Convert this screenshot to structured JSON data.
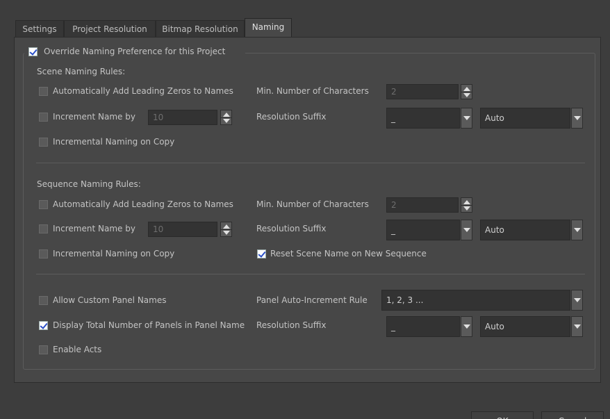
{
  "tabs": [
    {
      "label": "Settings"
    },
    {
      "label": "Project Resolution"
    },
    {
      "label": "Bitmap Resolution"
    },
    {
      "label": "Naming"
    }
  ],
  "override": {
    "label": "Override Naming Preference for this Project",
    "checked": true
  },
  "scene": {
    "title": "Scene Naming Rules:",
    "leading_zeros": {
      "label": "Automatically Add Leading Zeros to Names",
      "checked": false
    },
    "min_chars": {
      "label": "Min. Number of Characters",
      "value": "2"
    },
    "increment": {
      "label": "Increment Name by",
      "value": "10",
      "checked": false
    },
    "res_suffix": {
      "label": "Resolution Suffix",
      "value": "_",
      "mode": "Auto"
    },
    "incremental_copy": {
      "label": "Incremental Naming on Copy",
      "checked": false
    }
  },
  "sequence": {
    "title": "Sequence Naming Rules:",
    "leading_zeros": {
      "label": "Automatically Add Leading Zeros to Names",
      "checked": false
    },
    "min_chars": {
      "label": "Min. Number of Characters",
      "value": "2"
    },
    "increment": {
      "label": "Increment Name by",
      "value": "10",
      "checked": false
    },
    "res_suffix": {
      "label": "Resolution Suffix",
      "value": "_",
      "mode": "Auto"
    },
    "incremental_copy": {
      "label": "Incremental Naming on Copy",
      "checked": false
    },
    "reset_scene": {
      "label": "Reset Scene Name on New Sequence",
      "checked": true
    }
  },
  "panel": {
    "allow_custom": {
      "label": "Allow Custom Panel Names",
      "checked": false
    },
    "auto_increment": {
      "label": "Panel Auto-Increment Rule",
      "value": "1, 2, 3 ..."
    },
    "display_total": {
      "label": "Display Total Number of Panels in Panel Name",
      "checked": true
    },
    "res_suffix": {
      "label": "Resolution Suffix",
      "value": "_",
      "mode": "Auto"
    },
    "enable_acts": {
      "label": "Enable Acts",
      "checked": false
    }
  },
  "buttons": {
    "ok": "OK",
    "cancel": "Cancel"
  },
  "colors": {
    "background": "#3d3d3d",
    "panel": "#474747",
    "field": "#333333",
    "check_accent": "#2a4fc8"
  },
  "icons": [
    "checkbox-icon",
    "spin-up-icon",
    "spin-down-icon",
    "chevron-down-icon"
  ]
}
